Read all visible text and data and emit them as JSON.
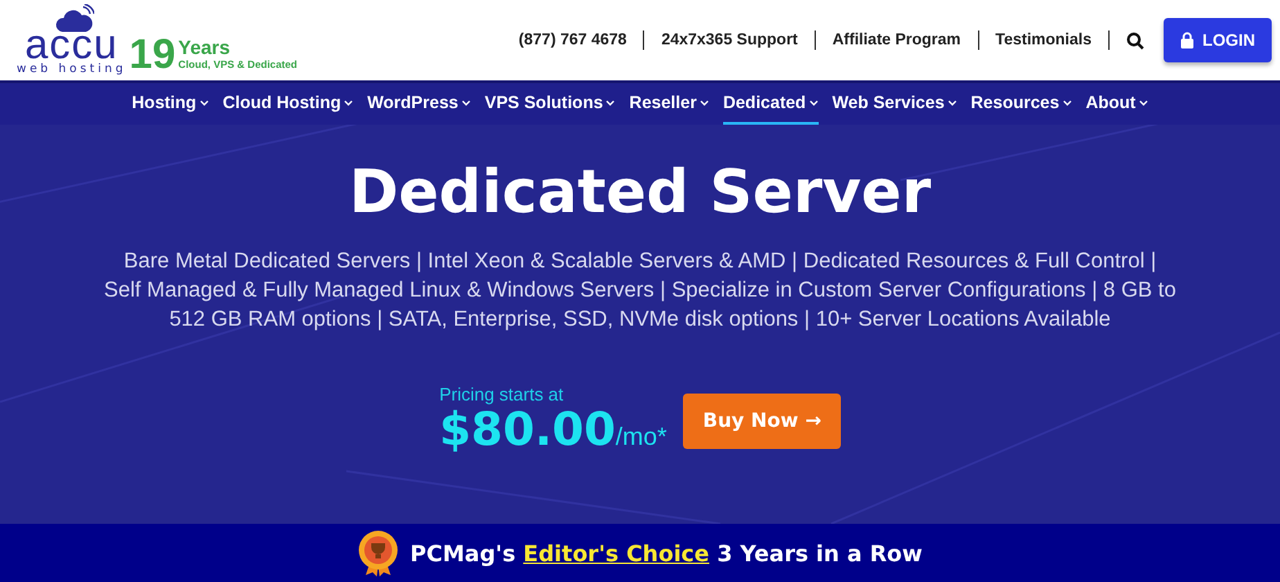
{
  "logo": {
    "brand": "accu",
    "tagline": "web hosting",
    "years_number": "19",
    "years_word": "Years",
    "years_sub": "Cloud, VPS & Dedicated"
  },
  "top_links": [
    "(877) 767 4678",
    "24x7x365 Support",
    "Affiliate Program",
    "Testimonials"
  ],
  "login_button": "LOGIN",
  "nav": [
    {
      "label": "Hosting",
      "selected": false
    },
    {
      "label": "Cloud Hosting",
      "selected": false
    },
    {
      "label": "WordPress",
      "selected": false
    },
    {
      "label": "VPS Solutions",
      "selected": false
    },
    {
      "label": "Reseller",
      "selected": false
    },
    {
      "label": "Dedicated",
      "selected": true
    },
    {
      "label": "Web Services",
      "selected": false
    },
    {
      "label": "Resources",
      "selected": false
    },
    {
      "label": "About",
      "selected": false
    }
  ],
  "hero": {
    "title": "Dedicated Server",
    "description": "Bare Metal Dedicated Servers | Intel Xeon & Scalable Servers & AMD | Dedicated Resources & Full Control | Self Managed & Fully Managed Linux & Windows Servers | Specialize in Custom Server Configurations | 8 GB to 512 GB RAM options | SATA, Enterprise, SSD, NVMe disk options | 10+ Server Locations Available",
    "pricing_label": "Pricing starts at",
    "price": "$80.00",
    "price_unit": "/mo*",
    "buy_button": "Buy Now →"
  },
  "award": {
    "prefix": "PCMag's",
    "link": "Editor's Choice",
    "suffix": "3 Years in a Row"
  }
}
